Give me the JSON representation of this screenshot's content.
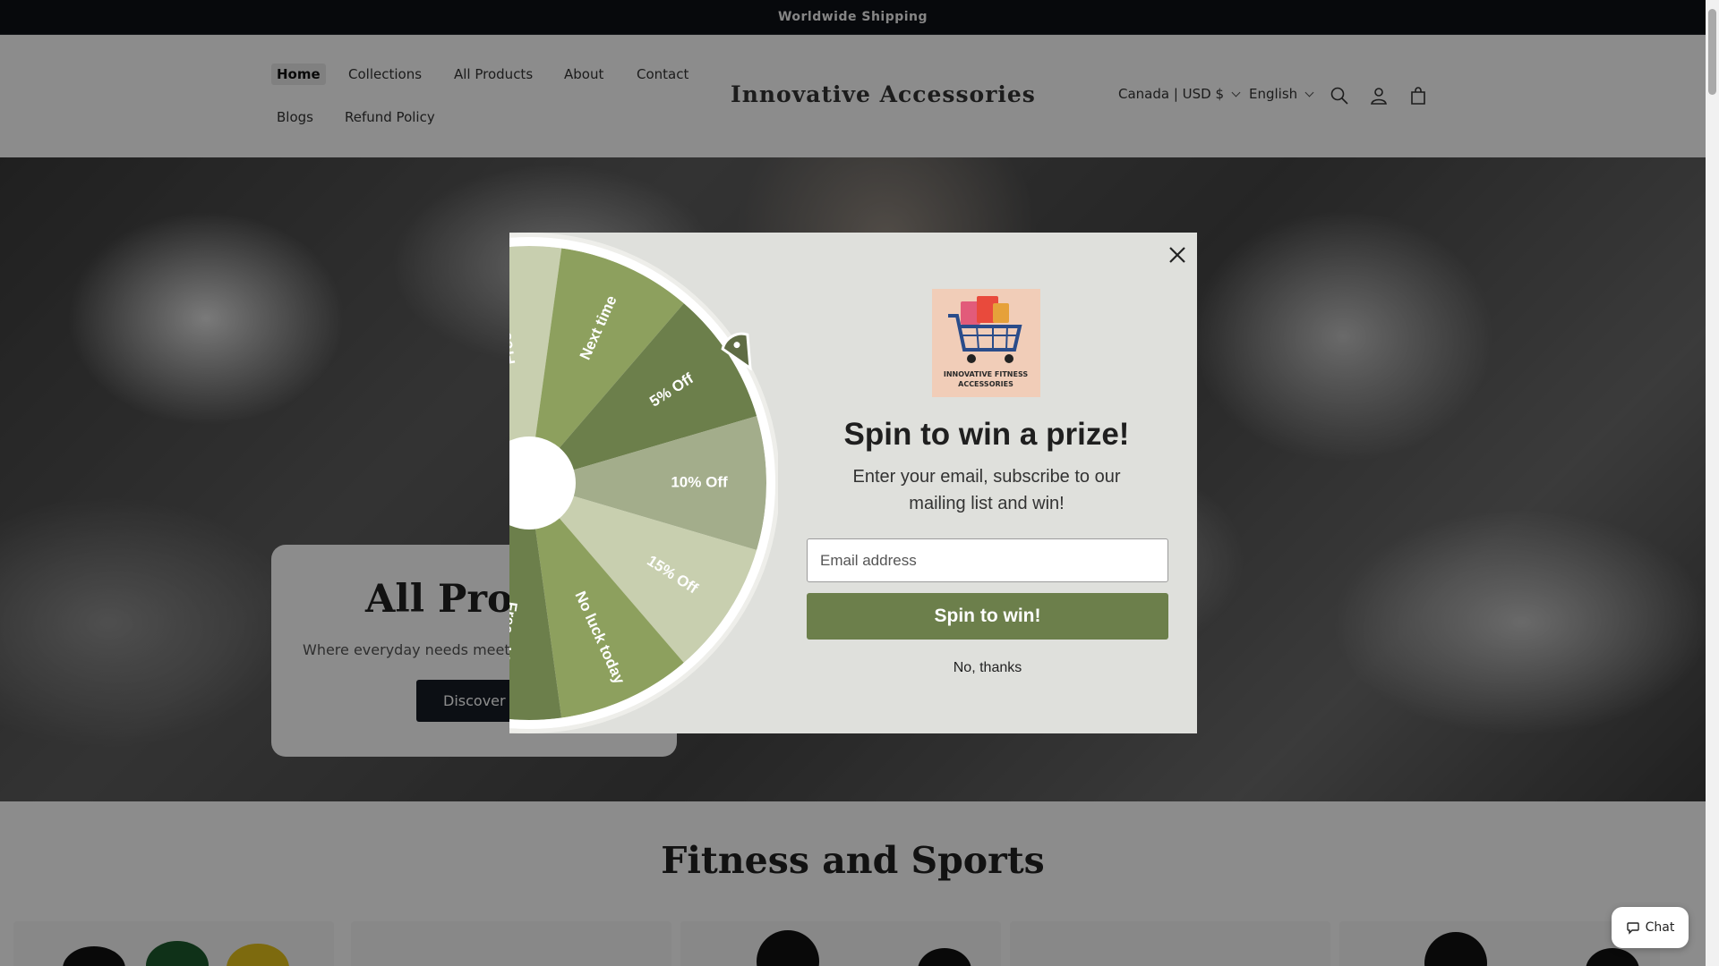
{
  "announcement": {
    "text": "Worldwide Shipping"
  },
  "header": {
    "nav": [
      "Home",
      "Collections",
      "All Products",
      "About",
      "Contact",
      "Blogs",
      "Refund Policy"
    ],
    "active": "Home",
    "brand": "Innovative Accessories",
    "country": "Canada | USD $",
    "language": "English",
    "icons": [
      "search-icon",
      "account-icon",
      "cart-icon"
    ]
  },
  "hero": {
    "title": "All Products",
    "subtitle": "Where everyday needs meet ease",
    "button_label": "Discover"
  },
  "section": {
    "title": "Fitness and Sports"
  },
  "popup": {
    "title": "Spin to win a prize!",
    "subtitle": "Enter your email, subscribe to our mailing list and win!",
    "email_placeholder": "Email address",
    "spin_label": "Spin to win!",
    "no_thanks": "No, thanks",
    "logo_text": [
      "INNOVATIVE FITNESS",
      "ACCESSORIES"
    ],
    "wheel_labels": [
      "Free shipping",
      "Next time",
      "5% Off",
      "10% Off",
      "15% Off",
      "No luck today",
      "Free shipping"
    ],
    "accent_color": "#6c7f4b"
  },
  "chat": {
    "label": "Chat"
  }
}
